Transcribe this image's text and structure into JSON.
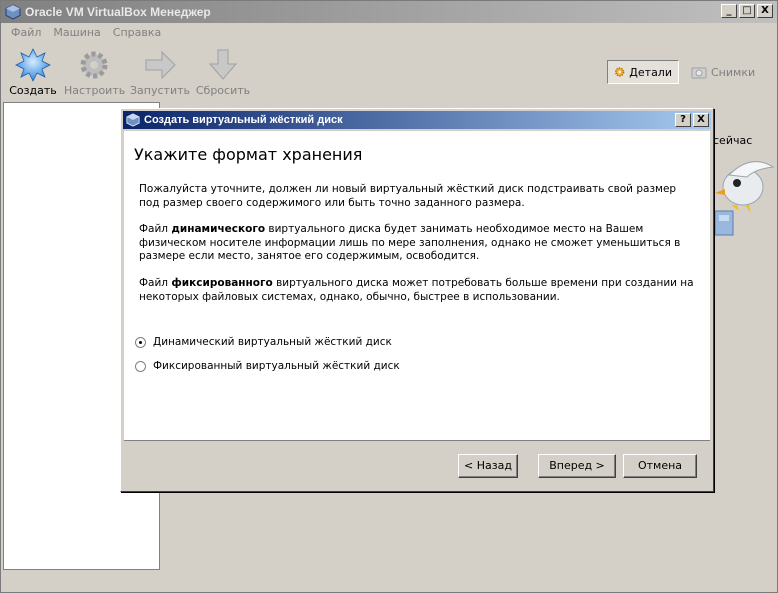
{
  "app": {
    "title": "Oracle VM VirtualBox Менеджер"
  },
  "window_controls": {
    "minimize": "_",
    "maximize": "□",
    "close": "X"
  },
  "menu": [
    "Файл",
    "Машина",
    "Справка"
  ],
  "toolbar": {
    "create": "Создать",
    "settings": "Настроить",
    "start": "Запустить",
    "discard": "Сбросить",
    "details": "Детали",
    "snapshots": "Снимки"
  },
  "right_peek": "сейчас",
  "dialog": {
    "title": "Создать виртуальный жёсткий диск",
    "help": "?",
    "close": "X",
    "heading": "Укажите формат хранения",
    "p1": "Пожалуйста уточните, должен ли новый виртуальный жёсткий диск подстраивать свой размер под размер своего содержимого или быть точно заданного размера.",
    "p2_pre": "Файл ",
    "p2_bold": "динамического",
    "p2_post": " виртуального диска будет занимать необходимое место на Вашем физическом носителе информации лишь по мере заполнения, однако не сможет уменьшиться в размере если место, занятое его содержимым, освободится.",
    "p3_pre": "Файл ",
    "p3_bold": "фиксированного",
    "p3_post": " виртуального диска может потребовать больше времени при создании на некоторых файловых системах, однако, обычно, быстрее в использовании.",
    "options": [
      {
        "label": "Динамический виртуальный жёсткий диск",
        "checked": true
      },
      {
        "label": "Фиксированный виртуальный жёсткий диск",
        "checked": false
      }
    ],
    "back": "< Назад",
    "next": "Вперед >",
    "cancel": "Отмена"
  }
}
